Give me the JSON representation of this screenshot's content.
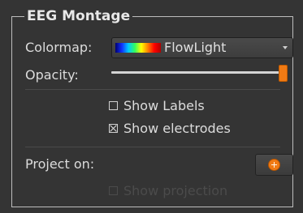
{
  "group": {
    "title": "EEG Montage"
  },
  "colormap": {
    "label": "Colormap:",
    "selected": "FlowLight"
  },
  "opacity": {
    "label": "Opacity:",
    "value": 1.0
  },
  "checkboxes": {
    "show_labels": {
      "label": "Show Labels",
      "checked": false
    },
    "show_electrodes": {
      "label": "Show electrodes",
      "checked": true
    },
    "show_projection": {
      "label": "Show projection",
      "checked": false,
      "enabled": false
    }
  },
  "project_on": {
    "label": "Project on:",
    "button_icon": "add-circle-icon"
  },
  "colors": {
    "background": "#343434",
    "accent": "#f07a14",
    "text": "#dcdcdc"
  }
}
